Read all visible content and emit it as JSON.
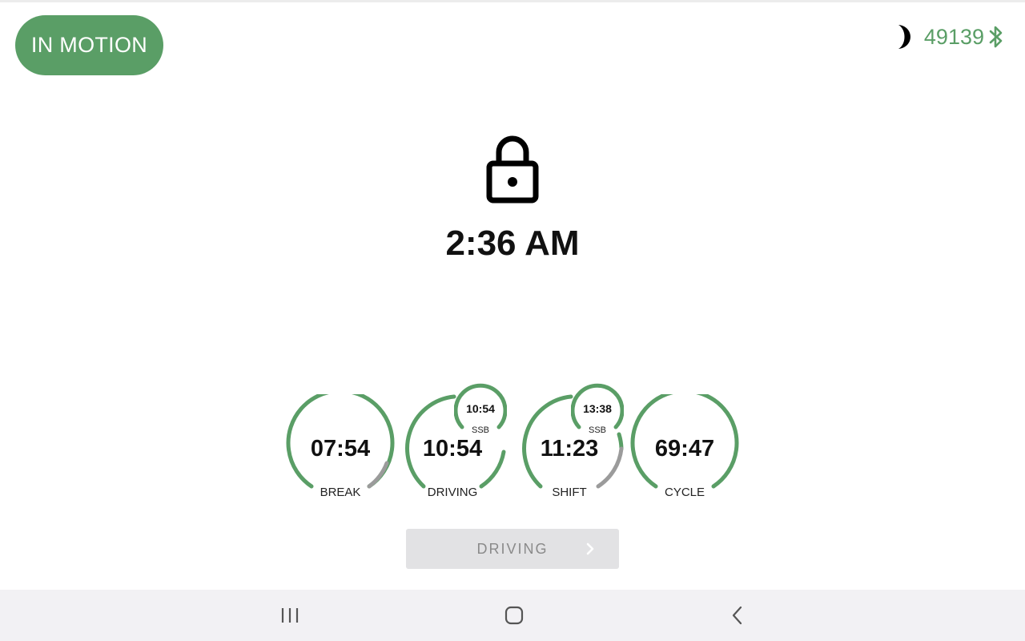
{
  "status": {
    "motion_label": "IN MOTION",
    "device_id": "49139",
    "night_mode_icon": "moon-icon",
    "connection_icon": "bluetooth-icon",
    "accent_color": "#5a9e66"
  },
  "lock": {
    "icon": "lock-icon",
    "time": "2:36 AM"
  },
  "gauges": [
    {
      "value": "07:54",
      "label": "BREAK"
    },
    {
      "value": "10:54",
      "label": "DRIVING",
      "sub": {
        "value": "10:54",
        "label": "SSB"
      }
    },
    {
      "value": "11:23",
      "label": "SHIFT",
      "sub": {
        "value": "13:38",
        "label": "SSB"
      }
    },
    {
      "value": "69:47",
      "label": "CYCLE"
    }
  ],
  "duty_button": {
    "label": "DRIVING",
    "icon": "chevron-right-icon"
  },
  "nav": {
    "recents_icon": "recents-icon",
    "home_icon": "home-icon",
    "back_icon": "back-icon"
  }
}
